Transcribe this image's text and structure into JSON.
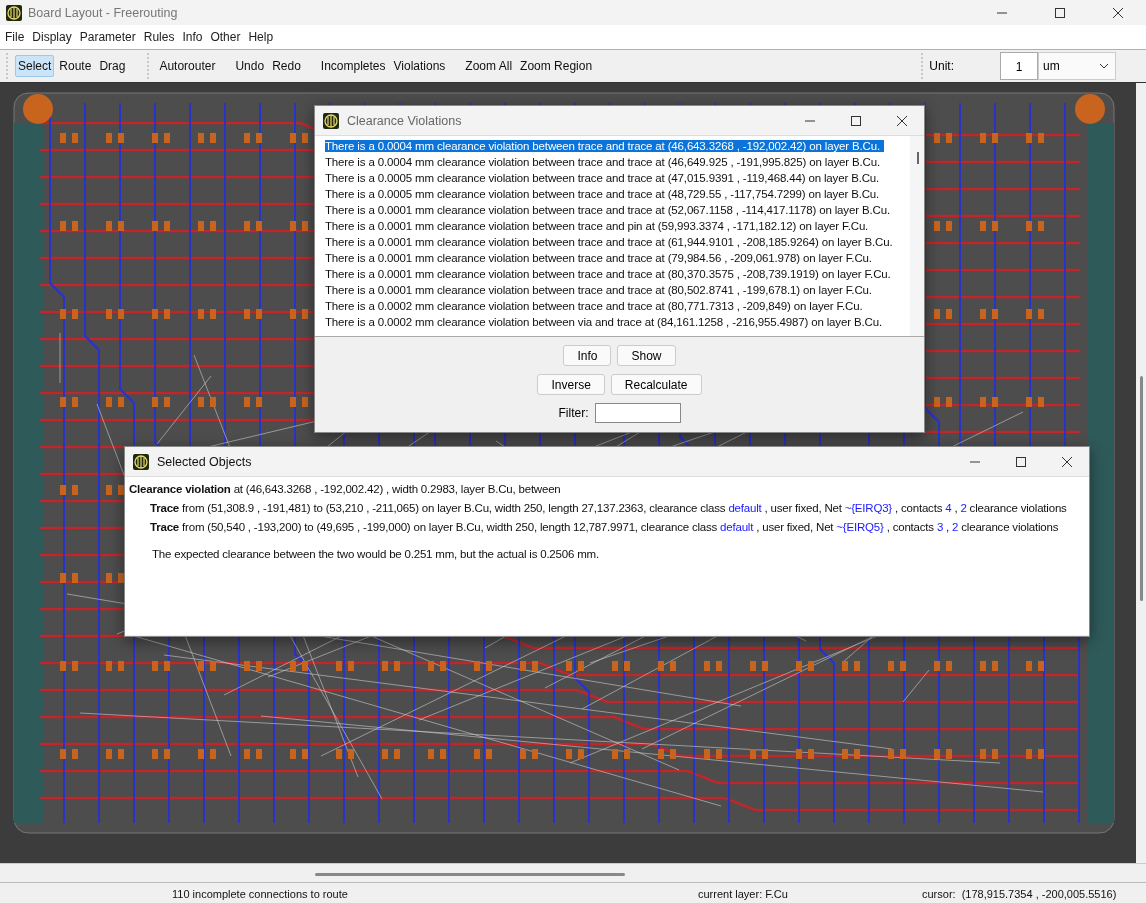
{
  "window": {
    "title": "Board Layout - Freerouting"
  },
  "menu": [
    "File",
    "Display",
    "Parameter",
    "Rules",
    "Info",
    "Other",
    "Help"
  ],
  "toolbar": {
    "modes": [
      {
        "label": "Select",
        "selected": true
      },
      {
        "label": "Route",
        "selected": false
      },
      {
        "label": "Drag",
        "selected": false
      }
    ],
    "groups": [
      [
        "Autorouter"
      ],
      [
        "Undo",
        "Redo"
      ],
      [
        "Incompletes",
        "Violations"
      ],
      [
        "Zoom All",
        "Zoom Region"
      ]
    ],
    "unit_label": "Unit:",
    "unit_value": "1",
    "unit": "um"
  },
  "violations_dialog": {
    "title": "Clearance Violations",
    "rows": [
      {
        "text": "There is a 0.0004 mm clearance violation between trace and trace at  (46,643.3268 , -192,002.42)  on layer B.Cu.",
        "selected": true
      },
      {
        "text": "There is a 0.0004 mm clearance violation between trace and trace at  (46,649.925 , -191,995.825)  on layer B.Cu.",
        "selected": false
      },
      {
        "text": "There is a 0.0005 mm clearance violation between trace and trace at  (47,015.9391 , -119,468.44)  on layer B.Cu.",
        "selected": false
      },
      {
        "text": "There is a 0.0005 mm clearance violation between trace and trace at  (48,729.55 , -117,754.7299)  on layer B.Cu.",
        "selected": false
      },
      {
        "text": "There is a 0.0001 mm clearance violation between trace and trace at  (52,067.1158 , -114,417.1178)  on layer B.Cu.",
        "selected": false
      },
      {
        "text": "There is a 0.0001 mm clearance violation between trace and pin at  (59,993.3374 , -171,182.12)  on layer F.Cu.",
        "selected": false
      },
      {
        "text": "There is a 0.0001 mm clearance violation between trace and trace at  (61,944.9101 , -208,185.9264)  on layer B.Cu.",
        "selected": false
      },
      {
        "text": "There is a 0.0001 mm clearance violation between trace and trace at  (79,984.56 , -209,061.978)  on layer F.Cu.",
        "selected": false
      },
      {
        "text": "There is a 0.0001 mm clearance violation between trace and trace at  (80,370.3575 , -208,739.1919)  on layer F.Cu.",
        "selected": false
      },
      {
        "text": "There is a 0.0001 mm clearance violation between trace and trace at  (80,502.8741 , -199,678.1)  on layer F.Cu.",
        "selected": false
      },
      {
        "text": "There is a 0.0002 mm clearance violation between trace and trace at  (80,771.7313 , -209,849)  on layer F.Cu.",
        "selected": false
      },
      {
        "text": "There is a 0.0002 mm clearance violation between via and trace at  (84,161.1258 , -216,955.4987)  on layer B.Cu.",
        "selected": false
      }
    ],
    "buttons": [
      [
        "Info",
        "Show"
      ],
      [
        "Inverse",
        "Recalculate"
      ]
    ],
    "filter_label": "Filter:"
  },
  "selected_objects": {
    "title": "Selected Objects",
    "lines": [
      {
        "kind": "header",
        "segments": [
          {
            "kind": "bold",
            "text": "Clearance violation"
          },
          {
            "kind": "plain",
            "text": " at  (46,643.3268 , -192,002.42) , width 0.2983, layer B.Cu, between"
          }
        ]
      },
      {
        "kind": "item",
        "segments": [
          {
            "kind": "bold",
            "text": "Trace"
          },
          {
            "kind": "plain",
            "text": " from (51,308.9 , -191,481) to (53,210 , -211,065) on layer B.Cu, width 250, length 27,137.2363, clearance class "
          },
          {
            "kind": "link",
            "text": "default"
          },
          {
            "kind": "plain",
            "text": " , user fixed, Net "
          },
          {
            "kind": "link",
            "text": "~{EIRQ3}"
          },
          {
            "kind": "plain",
            "text": " , contacts "
          },
          {
            "kind": "link",
            "text": "4"
          },
          {
            "kind": "plain",
            "text": " , "
          },
          {
            "kind": "link",
            "text": "2"
          },
          {
            "kind": "plain",
            "text": " clearance violations"
          }
        ]
      },
      {
        "kind": "item",
        "segments": [
          {
            "kind": "bold",
            "text": "Trace"
          },
          {
            "kind": "plain",
            "text": " from (50,540 , -193,200) to (49,695 , -199,000) on layer B.Cu, width 250, length 12,787.9971, clearance class "
          },
          {
            "kind": "link",
            "text": "default"
          },
          {
            "kind": "plain",
            "text": " , user fixed, Net "
          },
          {
            "kind": "link",
            "text": "~{EIRQ5}"
          },
          {
            "kind": "plain",
            "text": " , contacts "
          },
          {
            "kind": "link",
            "text": "3"
          },
          {
            "kind": "plain",
            "text": " , "
          },
          {
            "kind": "link",
            "text": "2"
          },
          {
            "kind": "plain",
            "text": " clearance violations"
          }
        ]
      },
      {
        "kind": "note",
        "segments": [
          {
            "kind": "plain",
            "text": "The expected clearance between the two would be 0.251 mm, but the actual is  0.2506 mm."
          }
        ]
      }
    ]
  },
  "status_bar": {
    "message": "110 incomplete connections to route",
    "layer": "current layer: F.Cu",
    "cursor_label": "cursor:",
    "cursor": "(178,915.7354 , -200,005.5516)"
  }
}
